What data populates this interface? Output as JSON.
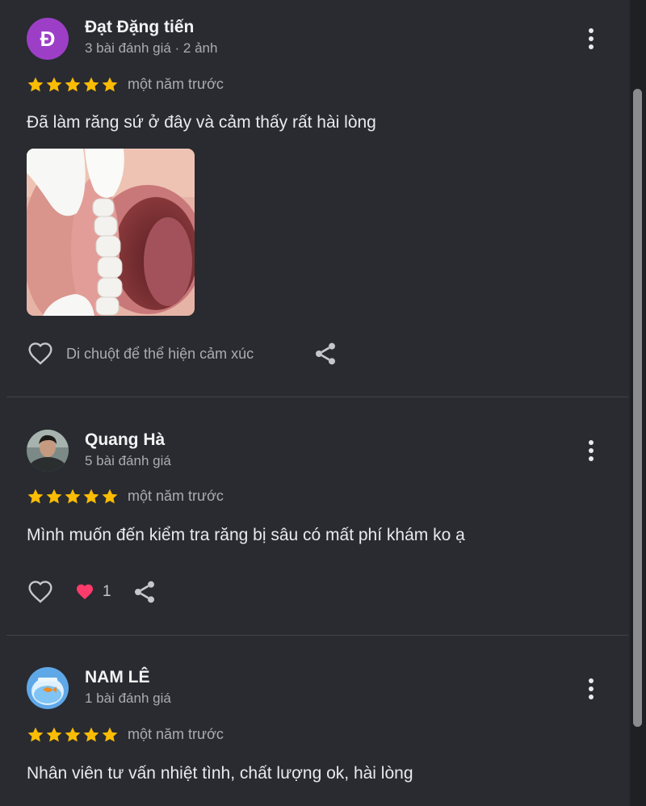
{
  "colors": {
    "background": "#292b30",
    "star": "#fbbc04",
    "heart_reaction": "#ff3b6b",
    "avatar_purple": "#9c3fc6"
  },
  "reviews": [
    {
      "avatar_letter": "Đ",
      "author": "Đạt Đặng tiến",
      "meta": "3 bài đánh giá · 2 ảnh",
      "rating": 5,
      "time": "một năm trước",
      "text": "Đã làm răng sứ ở đây và cảm thấy rất hài lòng",
      "react_hint": "Di chuột để thể hiện cảm xúc"
    },
    {
      "author": "Quang Hà",
      "meta": "5 bài đánh giá",
      "rating": 5,
      "time": "một năm trước",
      "text": "Mình muốn đến kiểm tra răng bị sâu có mất phí khám ko ạ",
      "reaction_count": "1"
    },
    {
      "author": "NAM LÊ",
      "meta": "1 bài đánh giá",
      "rating": 5,
      "time": "một năm trước",
      "text": "Nhân viên tư vấn nhiệt tình, chất lượng ok, hài lòng"
    }
  ]
}
